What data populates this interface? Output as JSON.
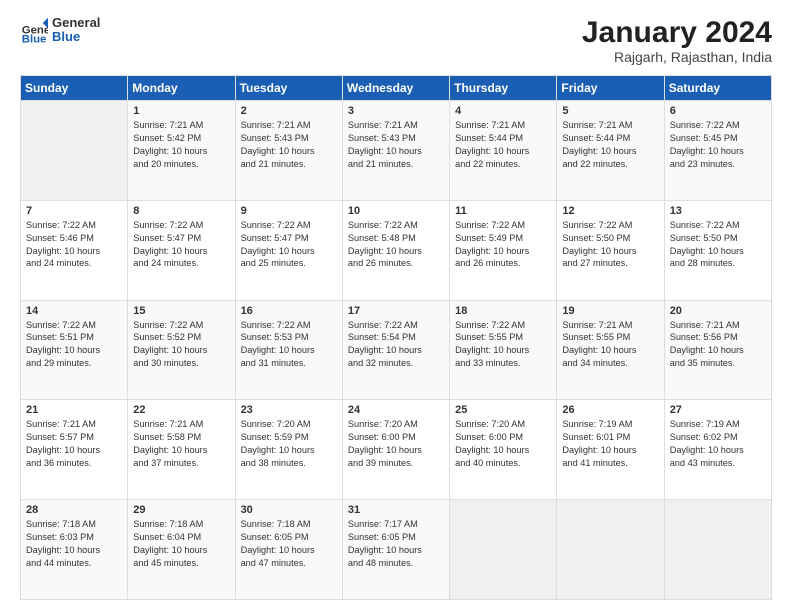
{
  "header": {
    "logo": {
      "general": "General",
      "blue": "Blue"
    },
    "title": "January 2024",
    "location": "Rajgarh, Rajasthan, India"
  },
  "weekdays": [
    "Sunday",
    "Monday",
    "Tuesday",
    "Wednesday",
    "Thursday",
    "Friday",
    "Saturday"
  ],
  "weeks": [
    [
      {
        "day": "",
        "sunrise": "",
        "sunset": "",
        "daylight": ""
      },
      {
        "day": "1",
        "sunrise": "Sunrise: 7:21 AM",
        "sunset": "Sunset: 5:42 PM",
        "daylight": "Daylight: 10 hours and 20 minutes."
      },
      {
        "day": "2",
        "sunrise": "Sunrise: 7:21 AM",
        "sunset": "Sunset: 5:43 PM",
        "daylight": "Daylight: 10 hours and 21 minutes."
      },
      {
        "day": "3",
        "sunrise": "Sunrise: 7:21 AM",
        "sunset": "Sunset: 5:43 PM",
        "daylight": "Daylight: 10 hours and 21 minutes."
      },
      {
        "day": "4",
        "sunrise": "Sunrise: 7:21 AM",
        "sunset": "Sunset: 5:44 PM",
        "daylight": "Daylight: 10 hours and 22 minutes."
      },
      {
        "day": "5",
        "sunrise": "Sunrise: 7:21 AM",
        "sunset": "Sunset: 5:44 PM",
        "daylight": "Daylight: 10 hours and 22 minutes."
      },
      {
        "day": "6",
        "sunrise": "Sunrise: 7:22 AM",
        "sunset": "Sunset: 5:45 PM",
        "daylight": "Daylight: 10 hours and 23 minutes."
      }
    ],
    [
      {
        "day": "7",
        "sunrise": "Sunrise: 7:22 AM",
        "sunset": "Sunset: 5:46 PM",
        "daylight": "Daylight: 10 hours and 24 minutes."
      },
      {
        "day": "8",
        "sunrise": "Sunrise: 7:22 AM",
        "sunset": "Sunset: 5:47 PM",
        "daylight": "Daylight: 10 hours and 24 minutes."
      },
      {
        "day": "9",
        "sunrise": "Sunrise: 7:22 AM",
        "sunset": "Sunset: 5:47 PM",
        "daylight": "Daylight: 10 hours and 25 minutes."
      },
      {
        "day": "10",
        "sunrise": "Sunrise: 7:22 AM",
        "sunset": "Sunset: 5:48 PM",
        "daylight": "Daylight: 10 hours and 26 minutes."
      },
      {
        "day": "11",
        "sunrise": "Sunrise: 7:22 AM",
        "sunset": "Sunset: 5:49 PM",
        "daylight": "Daylight: 10 hours and 26 minutes."
      },
      {
        "day": "12",
        "sunrise": "Sunrise: 7:22 AM",
        "sunset": "Sunset: 5:50 PM",
        "daylight": "Daylight: 10 hours and 27 minutes."
      },
      {
        "day": "13",
        "sunrise": "Sunrise: 7:22 AM",
        "sunset": "Sunset: 5:50 PM",
        "daylight": "Daylight: 10 hours and 28 minutes."
      }
    ],
    [
      {
        "day": "14",
        "sunrise": "Sunrise: 7:22 AM",
        "sunset": "Sunset: 5:51 PM",
        "daylight": "Daylight: 10 hours and 29 minutes."
      },
      {
        "day": "15",
        "sunrise": "Sunrise: 7:22 AM",
        "sunset": "Sunset: 5:52 PM",
        "daylight": "Daylight: 10 hours and 30 minutes."
      },
      {
        "day": "16",
        "sunrise": "Sunrise: 7:22 AM",
        "sunset": "Sunset: 5:53 PM",
        "daylight": "Daylight: 10 hours and 31 minutes."
      },
      {
        "day": "17",
        "sunrise": "Sunrise: 7:22 AM",
        "sunset": "Sunset: 5:54 PM",
        "daylight": "Daylight: 10 hours and 32 minutes."
      },
      {
        "day": "18",
        "sunrise": "Sunrise: 7:22 AM",
        "sunset": "Sunset: 5:55 PM",
        "daylight": "Daylight: 10 hours and 33 minutes."
      },
      {
        "day": "19",
        "sunrise": "Sunrise: 7:21 AM",
        "sunset": "Sunset: 5:55 PM",
        "daylight": "Daylight: 10 hours and 34 minutes."
      },
      {
        "day": "20",
        "sunrise": "Sunrise: 7:21 AM",
        "sunset": "Sunset: 5:56 PM",
        "daylight": "Daylight: 10 hours and 35 minutes."
      }
    ],
    [
      {
        "day": "21",
        "sunrise": "Sunrise: 7:21 AM",
        "sunset": "Sunset: 5:57 PM",
        "daylight": "Daylight: 10 hours and 36 minutes."
      },
      {
        "day": "22",
        "sunrise": "Sunrise: 7:21 AM",
        "sunset": "Sunset: 5:58 PM",
        "daylight": "Daylight: 10 hours and 37 minutes."
      },
      {
        "day": "23",
        "sunrise": "Sunrise: 7:20 AM",
        "sunset": "Sunset: 5:59 PM",
        "daylight": "Daylight: 10 hours and 38 minutes."
      },
      {
        "day": "24",
        "sunrise": "Sunrise: 7:20 AM",
        "sunset": "Sunset: 6:00 PM",
        "daylight": "Daylight: 10 hours and 39 minutes."
      },
      {
        "day": "25",
        "sunrise": "Sunrise: 7:20 AM",
        "sunset": "Sunset: 6:00 PM",
        "daylight": "Daylight: 10 hours and 40 minutes."
      },
      {
        "day": "26",
        "sunrise": "Sunrise: 7:19 AM",
        "sunset": "Sunset: 6:01 PM",
        "daylight": "Daylight: 10 hours and 41 minutes."
      },
      {
        "day": "27",
        "sunrise": "Sunrise: 7:19 AM",
        "sunset": "Sunset: 6:02 PM",
        "daylight": "Daylight: 10 hours and 43 minutes."
      }
    ],
    [
      {
        "day": "28",
        "sunrise": "Sunrise: 7:18 AM",
        "sunset": "Sunset: 6:03 PM",
        "daylight": "Daylight: 10 hours and 44 minutes."
      },
      {
        "day": "29",
        "sunrise": "Sunrise: 7:18 AM",
        "sunset": "Sunset: 6:04 PM",
        "daylight": "Daylight: 10 hours and 45 minutes."
      },
      {
        "day": "30",
        "sunrise": "Sunrise: 7:18 AM",
        "sunset": "Sunset: 6:05 PM",
        "daylight": "Daylight: 10 hours and 47 minutes."
      },
      {
        "day": "31",
        "sunrise": "Sunrise: 7:17 AM",
        "sunset": "Sunset: 6:05 PM",
        "daylight": "Daylight: 10 hours and 48 minutes."
      },
      {
        "day": "",
        "sunrise": "",
        "sunset": "",
        "daylight": ""
      },
      {
        "day": "",
        "sunrise": "",
        "sunset": "",
        "daylight": ""
      },
      {
        "day": "",
        "sunrise": "",
        "sunset": "",
        "daylight": ""
      }
    ]
  ]
}
